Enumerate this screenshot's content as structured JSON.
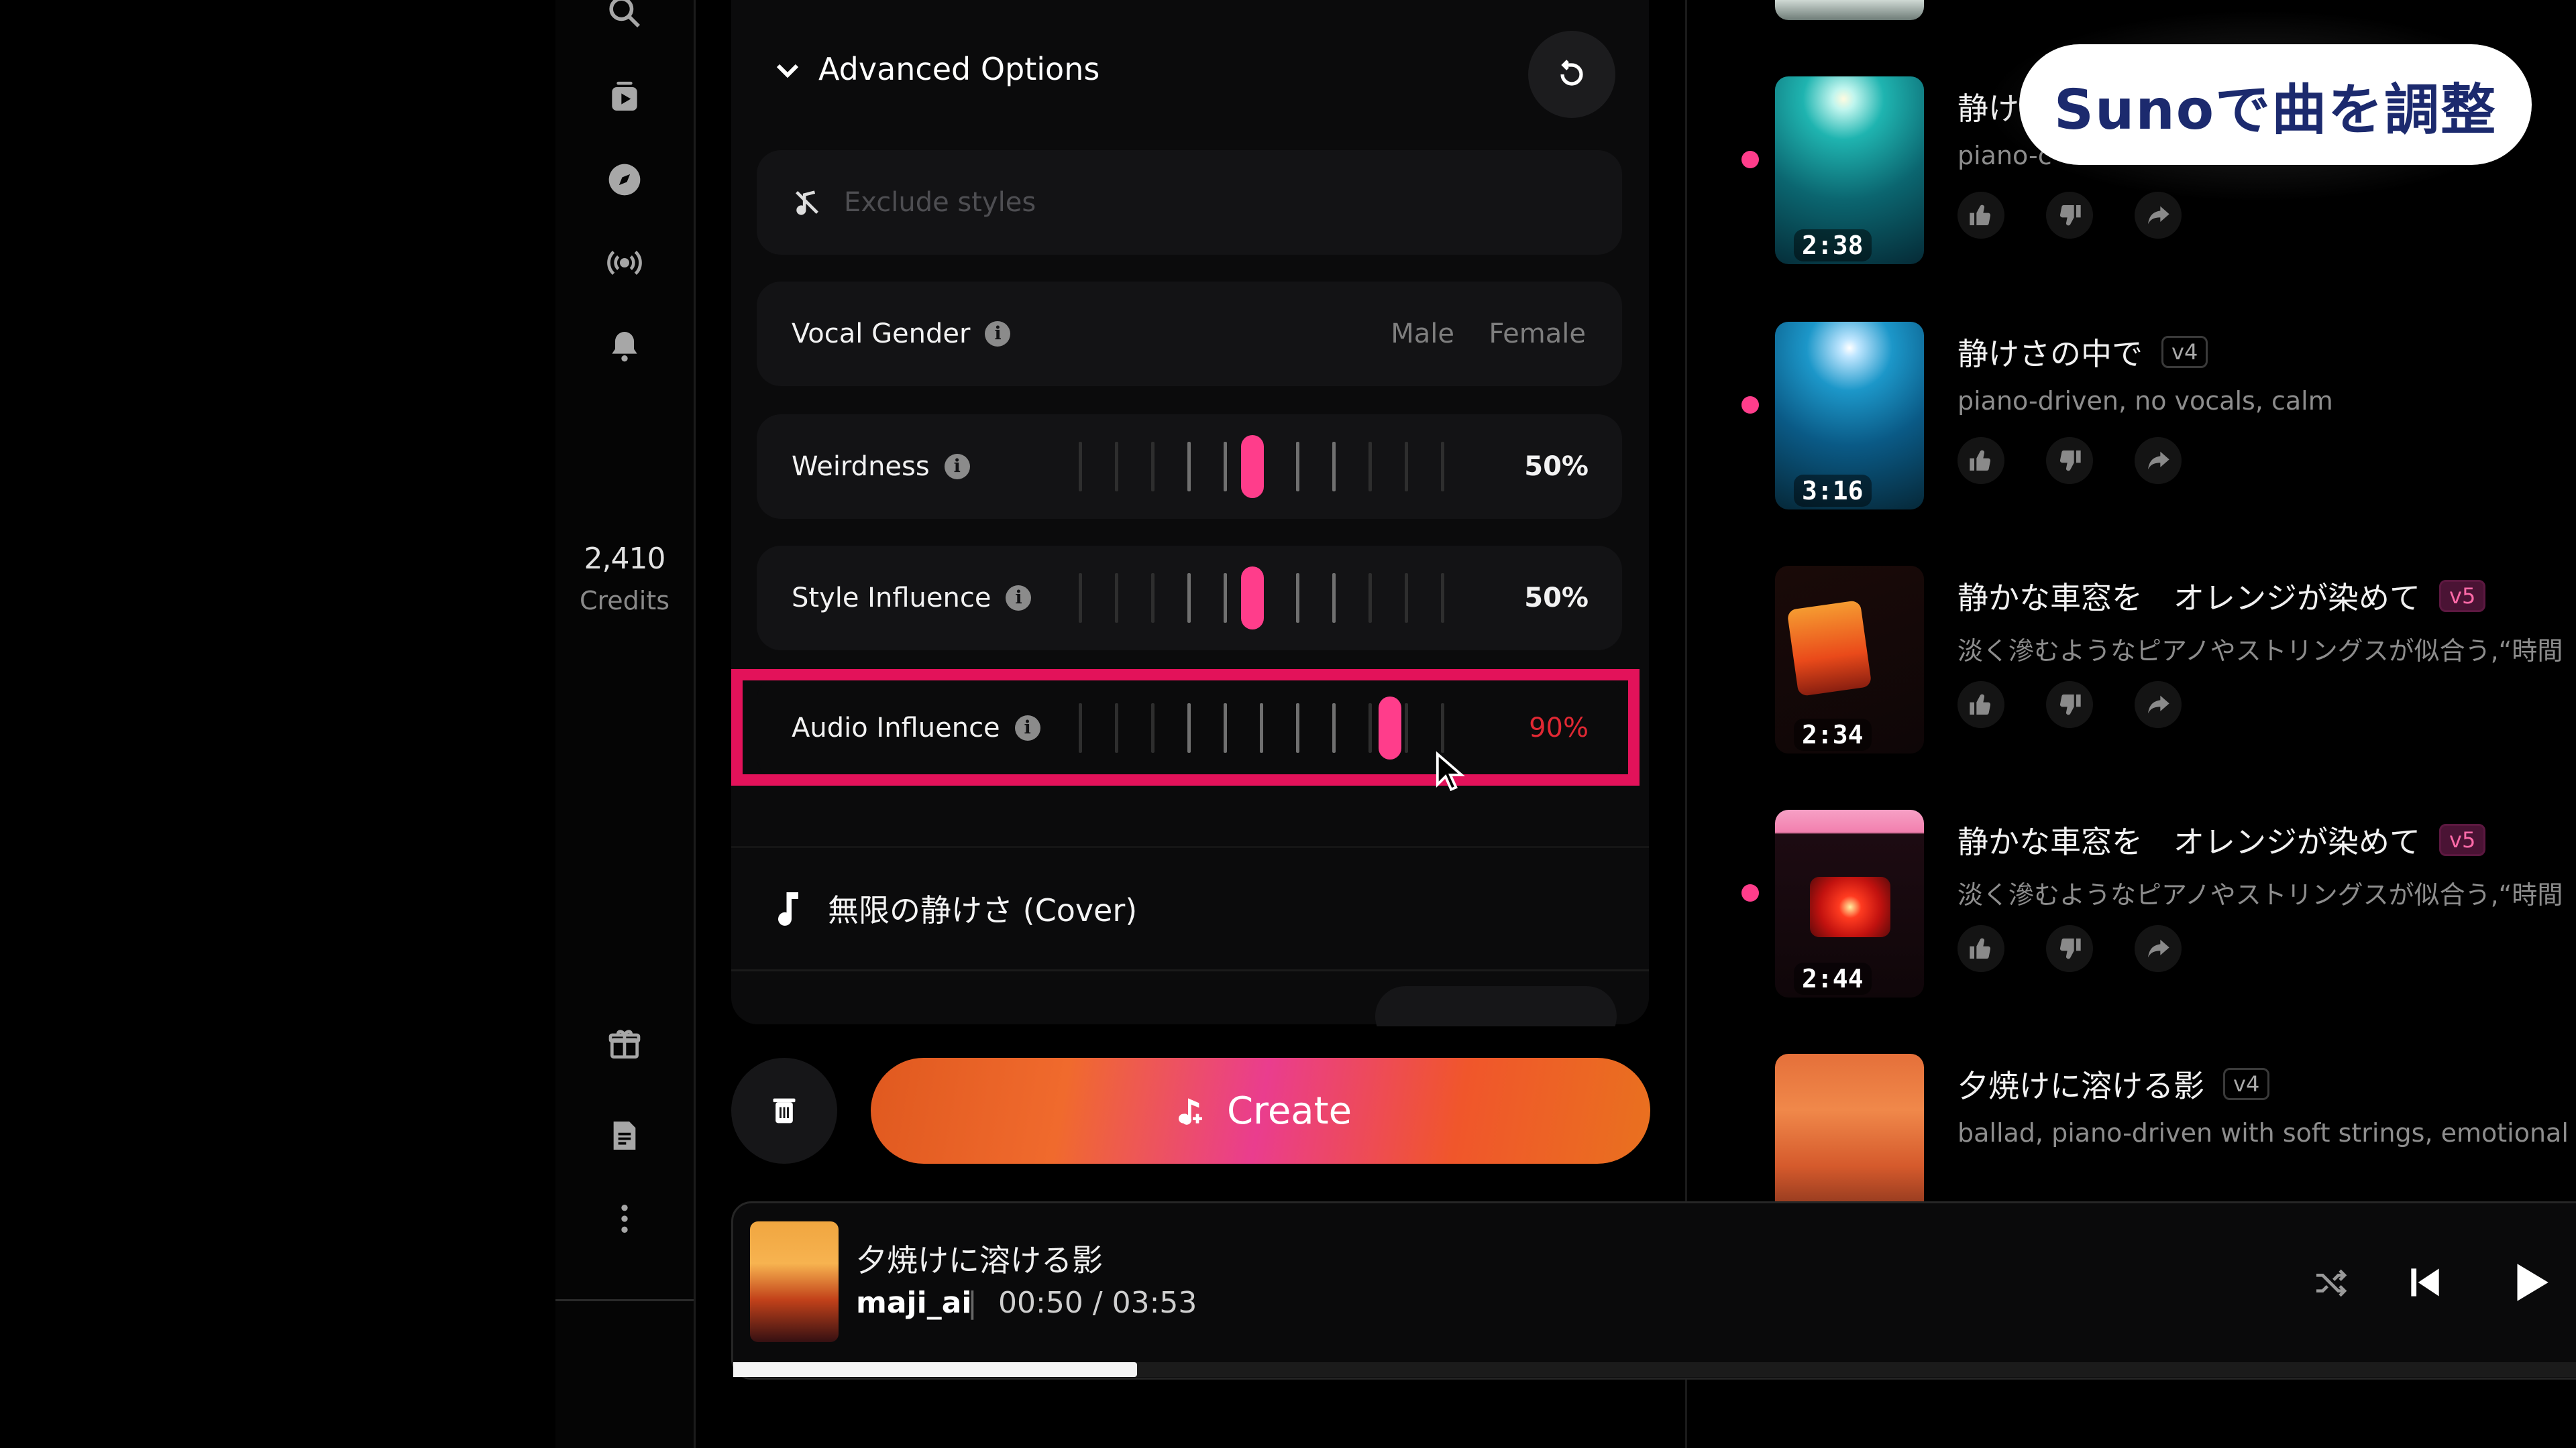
{
  "sidebar": {
    "credits": "2,410",
    "credits_label": "Credits"
  },
  "advanced": {
    "title": "Advanced Options",
    "exclude_placeholder": "Exclude styles",
    "vocal_gender": {
      "label": "Vocal Gender",
      "male": "Male",
      "female": "Female"
    },
    "weirdness": {
      "label": "Weirdness",
      "value": "50%",
      "level": 0.5
    },
    "style_influence": {
      "label": "Style Influence",
      "value": "50%",
      "level": 0.5
    },
    "audio_influence": {
      "label": "Audio Influence",
      "value": "90%",
      "level": 0.9
    }
  },
  "cover": {
    "title": "無限の静けさ (Cover)"
  },
  "create": {
    "label": "Create"
  },
  "overlay": {
    "label": "Sunoで曲を調整"
  },
  "songs": [
    {
      "title": "静け",
      "badge": "",
      "subtitle": "piano-c",
      "duration": "2:38"
    },
    {
      "title": "静けさの中で",
      "badge": "v4",
      "subtitle": "piano-driven, no vocals, calm",
      "duration": "3:16"
    },
    {
      "title": "静かな車窓を　オレンジが染めて",
      "badge": "v5",
      "subtitle": "淡く滲むようなピアノやストリングスが似合う,“時間",
      "duration": "2:34"
    },
    {
      "title": "静かな車窓を　オレンジが染めて",
      "badge": "v5",
      "subtitle": "淡く滲むようなピアノやストリングスが似合う,“時間",
      "duration": "2:44"
    },
    {
      "title": "夕焼けに溶ける影",
      "badge": "v4",
      "subtitle": "ballad, piano-driven with soft strings, emotional",
      "duration": ""
    }
  ],
  "player": {
    "title": "夕焼けに溶ける影",
    "artist": "maji_ai",
    "separator": "|",
    "time": "00:50 /  03:53",
    "progress": 0.215
  }
}
